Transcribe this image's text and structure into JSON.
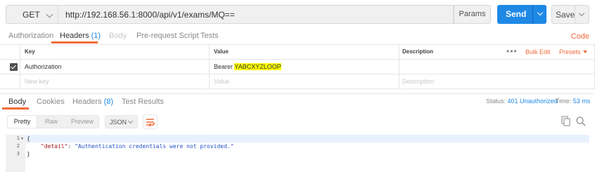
{
  "request": {
    "method": "GET",
    "url": "http://192.168.56.1:8000/api/v1/exams/MQ==",
    "params_label": "Params",
    "send_label": "Send",
    "save_label": "Save"
  },
  "request_tabs": {
    "authorization": "Authorization",
    "headers": "Headers",
    "headers_count": "(1)",
    "body": "Body",
    "pre_request": "Pre-request Script",
    "tests": "Tests",
    "code": "Code"
  },
  "headers_table": {
    "col_key": "Key",
    "col_value": "Value",
    "col_description": "Description",
    "bulk_edit": "Bulk Edit",
    "presets": "Presets",
    "rows": [
      {
        "key": "Authorization",
        "value_prefix": "Bearer ",
        "value_highlight": "YABCXYZLOOP",
        "description": "",
        "checked": true
      }
    ],
    "placeholder_key": "New key",
    "placeholder_value": "Value",
    "placeholder_description": "Description"
  },
  "response_tabs": {
    "body": "Body",
    "cookies": "Cookies",
    "headers": "Headers",
    "headers_count": "(8)",
    "test_results": "Test Results",
    "status_label": "Status:",
    "status_value": "401 Unauthorized",
    "time_label": "Time:",
    "time_value": "53 ms"
  },
  "response_toolbar": {
    "pretty": "Pretty",
    "raw": "Raw",
    "preview": "Preview",
    "format": "JSON"
  },
  "response_body": {
    "line_numbers": [
      "1",
      "2",
      "3"
    ],
    "line1": "{",
    "key": "\"detail\"",
    "colon": ": ",
    "value": "\"Authentication credentials were not provided.\"",
    "line3": "}"
  },
  "colors": {
    "accent": "#f26b3a",
    "send": "#1e88e5",
    "status": "#1e88e5"
  },
  "icons": [
    "chevron-down-icon",
    "checkbox-icon",
    "more-icon",
    "wrap-lines-icon",
    "copy-icon",
    "search-icon",
    "caret-down-icon"
  ]
}
